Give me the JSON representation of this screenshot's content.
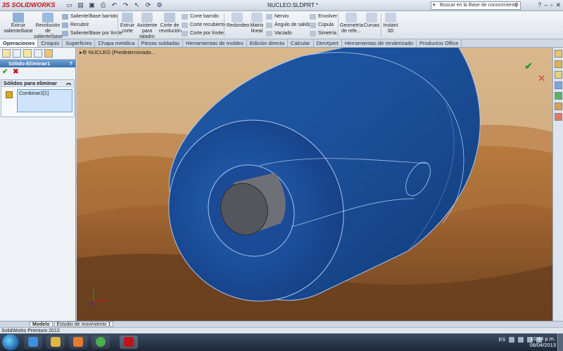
{
  "app": {
    "logo_prefix": "3S",
    "logo_text": "SOLIDWORKS",
    "document_title": "NUCLEO.SLDPRT *",
    "search_placeholder": "Buscar en la Base de conocimiento"
  },
  "ribbon": {
    "extrude_boss": "Extruir saliente/base",
    "revolve_boss": "Revolución de saliente/base",
    "swept_boss": "Saliente/Base barrido",
    "loft": "Recubrir",
    "boundary_boss": "Saliente/Base por límite",
    "extrude_cut": "Extruir corte",
    "hole_wizard": "Asistente para taladro",
    "revolve_cut": "Corte de revolución",
    "swept_cut": "Corte barrido",
    "lofted_cut": "Corte recubierto",
    "boundary_cut": "Corte por límite",
    "fillet": "Redondeo",
    "linear_pattern": "Matriz lineal",
    "rib": "Nervio",
    "draft": "Ángulo de salida",
    "shell": "Vaciado",
    "wrap": "Envolver",
    "dome": "Cúpula",
    "mirror": "Simetría",
    "ref_geometry": "Geometría de refe...",
    "curves": "Curvas",
    "instant3d": "Instant 3D"
  },
  "tabs": [
    "Operaciones",
    "Croquis",
    "Superficies",
    "Chapa metálica",
    "Piezas soldadas",
    "Herramientas de moldes",
    "Edición directa",
    "Calcular",
    "DimXpert",
    "Herramientas de renderizado",
    "Productos Office"
  ],
  "panel": {
    "feature_title": "Sólido-Eliminar1",
    "help": "?",
    "group_title": "Sólidos para eliminar",
    "bodies": [
      "Combinar2[1]"
    ]
  },
  "viewport": {
    "tree_label": "NUCLEO  (Predeterminado..."
  },
  "bottom_tabs": [
    "Modelo",
    "Estudio de movimiento 1"
  ],
  "status": "SolidWorks Premium 2013",
  "taskbar": {
    "language": "ES",
    "time": "10:44 p.m.",
    "date": "08/04/2013"
  },
  "colors": {
    "body_blue": "#1e4f9c",
    "body_edge": "#a9c4ee",
    "hub_gray": "#5a5c63",
    "selection": "#cfe4fb"
  }
}
